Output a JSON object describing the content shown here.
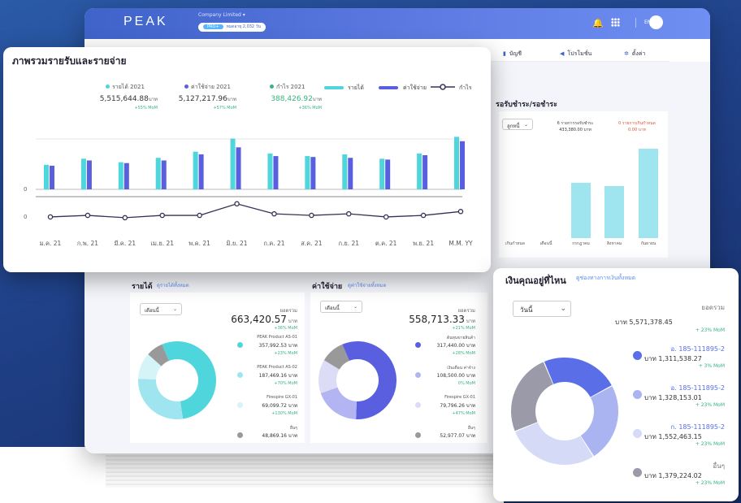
{
  "header": {
    "logo": "PEAK",
    "company": "Company Limited",
    "plan_badge": "PRO+",
    "plan_text": "หมดอายุ 2,032 วัน",
    "lang": "EN"
  },
  "menu": {
    "items": [
      {
        "label": "บัญชี"
      },
      {
        "label": "โปรโมชั่น"
      },
      {
        "label": "ตั้งค่า"
      }
    ]
  },
  "overview": {
    "title": "ภาพรวมรายรับและรายจ่าย",
    "stats": [
      {
        "label": "รายได้ 2021",
        "value": "5,515,644.88",
        "unit": "บาท",
        "mom": "+55% MoM",
        "color": "#4fd6dc"
      },
      {
        "label": "ค่าใช้จ่าย 2021",
        "value": "5,127,217.96",
        "unit": "บาท",
        "mom": "+57% MoM",
        "color": "#5a5fe0"
      },
      {
        "label": "กำไร 2021",
        "value": "388,426.92",
        "unit": "บาท",
        "mom": "+36% MoM",
        "color": "#36b37e"
      }
    ],
    "legend": [
      "รายได้",
      "ค่าใช้จ่าย",
      "กำไร"
    ]
  },
  "chart_data": {
    "type": "bar",
    "categories": [
      "ม.ค. 21",
      "ก.พ. 21",
      "มี.ค. 21",
      "เม.ย. 21",
      "พ.ค. 21",
      "มิ.ย. 21",
      "ก.ค. 21",
      "ส.ค. 21",
      "ก.ย. 21",
      "ต.ค. 21",
      "พ.ย. 21",
      "M.M. YY"
    ],
    "series": [
      {
        "name": "รายได้",
        "values": [
          28,
          35,
          31,
          36,
          43,
          58,
          41,
          38,
          40,
          35,
          41,
          60
        ],
        "color": "#4fd6dc"
      },
      {
        "name": "ค่าใช้จ่าย",
        "values": [
          27,
          33,
          30,
          33,
          40,
          48,
          38,
          37,
          36,
          34,
          39,
          55
        ],
        "color": "#5a5fe0"
      },
      {
        "name": "กำไร",
        "values": [
          -1,
          1,
          -2,
          1,
          1,
          16,
          3,
          1,
          3,
          -1,
          1,
          6
        ],
        "color": "#333355"
      }
    ],
    "ytick_labels": [
      "0",
      "0"
    ]
  },
  "receivables": {
    "title": "รอรับชำระ/รอชำระ",
    "select": "ลูกหนี้",
    "col1_label": "6 รายการรอรับชำระ",
    "col1_value": "433,380.00 บาท",
    "col2_label": "0 รายการเกินกำหนด",
    "col2_value": "0.00 บาท",
    "bars": [
      {
        "label": "เกินกำหนด",
        "value": 0
      },
      {
        "label": "เดือนนี้",
        "value": 0
      },
      {
        "label": "กรกฎาคม",
        "value": 0.62
      },
      {
        "label": "สิงหาคม",
        "value": 0.58
      },
      {
        "label": "กันยายน",
        "value": 1.0
      }
    ]
  },
  "income": {
    "title": "รายได้",
    "link": "ดูรายได้ทั้งหมด",
    "select": "เดือนนี้",
    "total_label": "ยอดรวม",
    "total": "663,420.57",
    "unit": "บาท",
    "total_mom": "+36% MoM",
    "items": [
      {
        "name": "PEAK Product AS-01",
        "value": "357,992.53",
        "mom": "+23% MoM",
        "color": "#4fd6dc",
        "share": 54
      },
      {
        "name": "PEAK Product AS-02",
        "value": "187,469.16",
        "mom": "+70% MoM",
        "color": "#9fe5ef",
        "share": 28
      },
      {
        "name": "Firespire GX-01",
        "value": "69,099.72",
        "mom": "+130% MoM",
        "color": "#d4f4f7",
        "share": 11
      },
      {
        "name": "อื่นๆ",
        "value": "48,869.16",
        "mom": "",
        "color": "#999999",
        "share": 7
      }
    ]
  },
  "expense": {
    "title": "ค่าใช้จ่าย",
    "link": "ดูค่าใช้จ่ายทั้งหมด",
    "select": "เดือนนี้",
    "total_label": "ยอดรวม",
    "total": "558,713.33",
    "unit": "บาท",
    "total_mom": "+21% MoM",
    "items": [
      {
        "name": "ต้นทุนขายสินค้า",
        "value": "317,440.00",
        "mom": "+28% MoM",
        "color": "#5a5fe0",
        "share": 57
      },
      {
        "name": "เงินเดือน ค่าจ้าง",
        "value": "108,500.00",
        "mom": "0% MoM",
        "color": "#b3b5f3",
        "share": 19
      },
      {
        "name": "Firespire GX-01",
        "value": "79,796.26",
        "mom": "+47% MoM",
        "color": "#dcdcf7",
        "share": 14
      },
      {
        "name": "อื่นๆ",
        "value": "52,977.07",
        "mom": "",
        "color": "#999999",
        "share": 10
      }
    ]
  },
  "wallet": {
    "title": "เงินคุณอยู่ที่ไหน",
    "link": "ดูช่องทางการเงินทั้งหมด",
    "select": "วันนี้",
    "total_label": "ยอดรวม",
    "unit": "บาท",
    "total": "5,571,378.45",
    "total_mom": "+ 23% MoM",
    "accounts": [
      {
        "name": "อ. 185-111895-2",
        "value": "1,311,538.27",
        "mom": "+ 3% MoM",
        "color": "#5a6ee8",
        "share": 23.5
      },
      {
        "name": "อ. 185-111895-2",
        "value": "1,328,153.01",
        "mom": "+ 23% MoM",
        "color": "#a9b4f0",
        "share": 23.8
      },
      {
        "name": "ก. 185-111895-2",
        "value": "1,552,463.15",
        "mom": "+ 23% MoM",
        "color": "#d5daf7",
        "share": 27.9
      },
      {
        "name": "อื่นๆ",
        "value": "1,379,224.02",
        "mom": "+ 23% MoM",
        "color": "#9a9aa8",
        "share": 24.8
      }
    ]
  }
}
